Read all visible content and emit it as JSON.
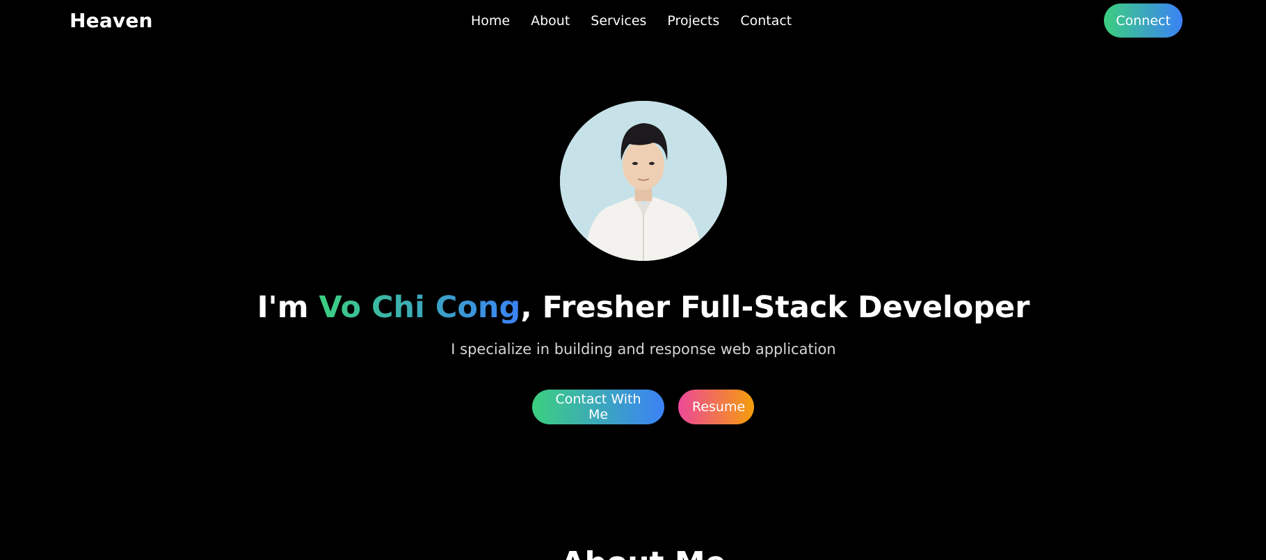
{
  "nav": {
    "brand": "Heaven",
    "links": [
      "Home",
      "About",
      "Services",
      "Projects",
      "Contact"
    ],
    "connect_label": "Connect"
  },
  "hero": {
    "title_prefix": "I'm ",
    "name": "Vo Chi Cong",
    "title_suffix": ", Fresher Full-Stack Developer",
    "subtitle": "I specialize in building and response web application",
    "contact_button": "Contact With Me",
    "resume_button": "Resume"
  },
  "about": {
    "heading": "About Me"
  },
  "colors": {
    "background": "#000000",
    "gradient_green": "#3ccf7f",
    "gradient_blue": "#3b82f6",
    "gradient_pink": "#ec4899",
    "gradient_orange": "#f59e0b"
  }
}
